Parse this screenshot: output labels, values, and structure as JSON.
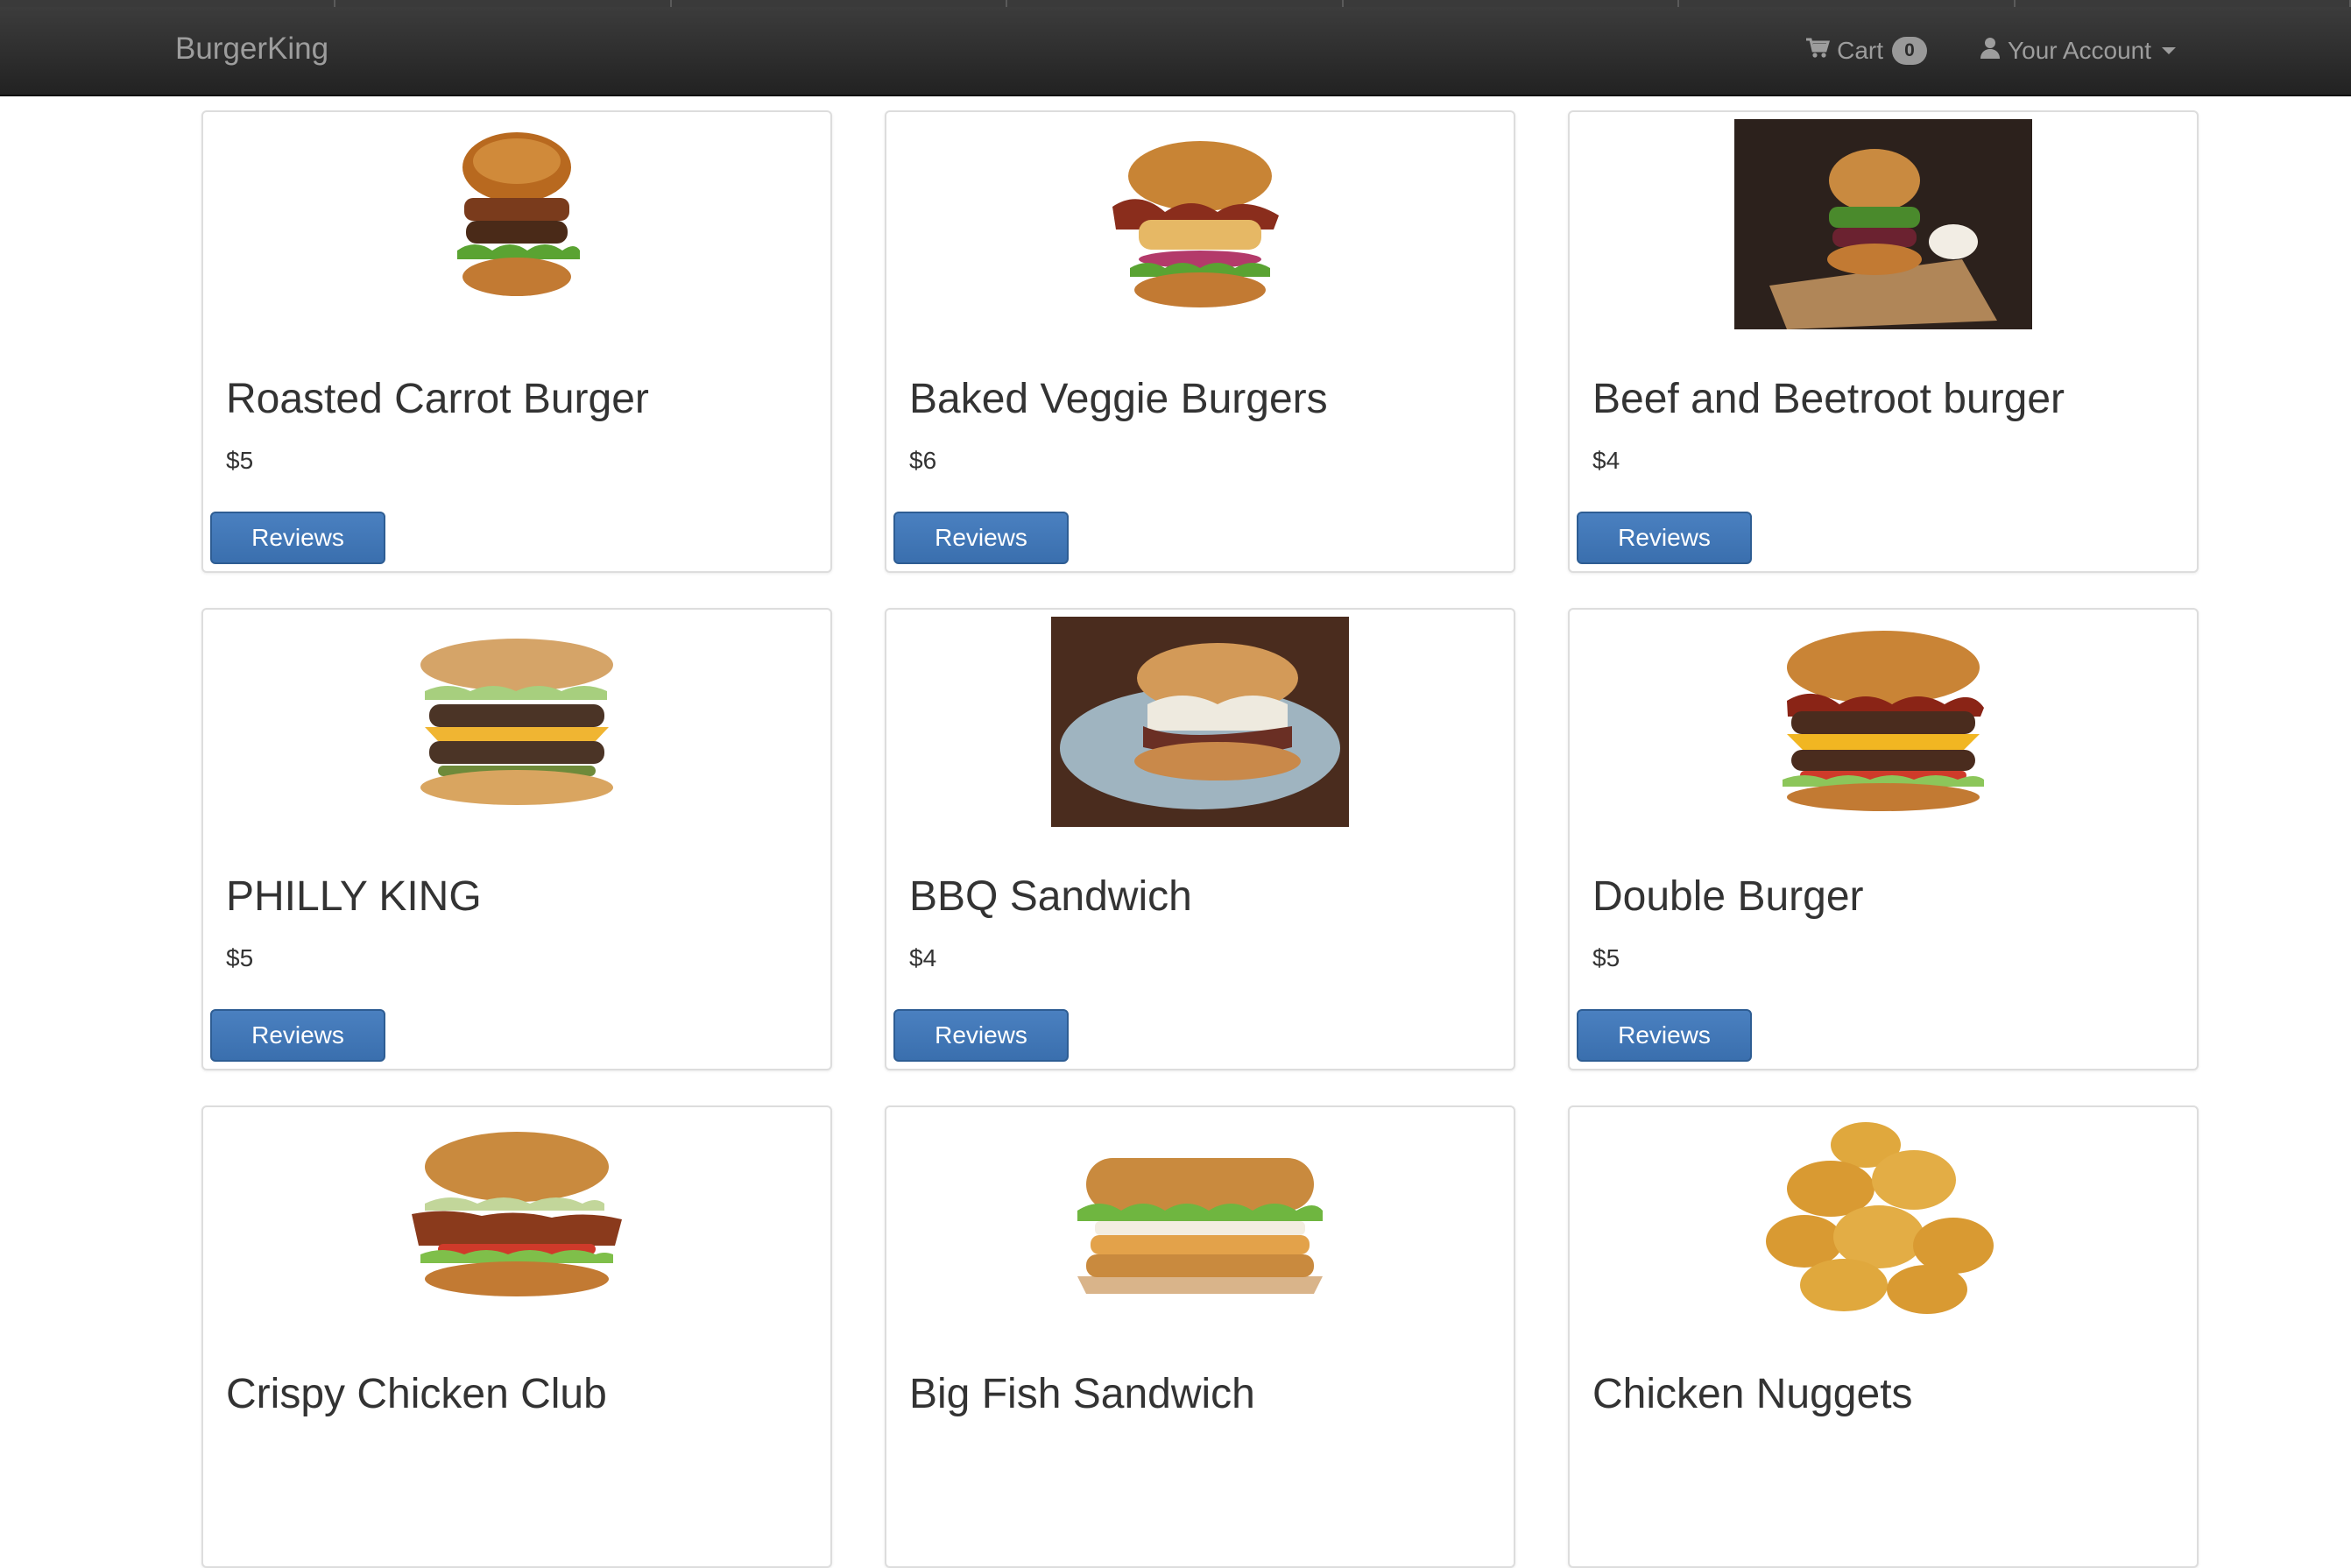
{
  "navbar": {
    "brand": "BurgerKing",
    "cart_label": "Cart",
    "cart_count": "0",
    "account_label": "Your Account",
    "background": "#222222",
    "text_color": "#9d9d9d"
  },
  "products": [
    {
      "name": "Roasted Carrot Burger",
      "price": "$5",
      "button_label": "Reviews",
      "image": "burger-image"
    },
    {
      "name": "Baked Veggie Burgers",
      "price": "$6",
      "button_label": "Reviews",
      "image": "bacon-chicken-burger-image"
    },
    {
      "name": "Beef and Beetroot burger",
      "price": "$4",
      "button_label": "Reviews",
      "image": "burger-on-board-photo"
    },
    {
      "name": "PHILLY KING",
      "price": "$5",
      "button_label": "Reviews",
      "image": "double-cheeseburger-image"
    },
    {
      "name": "BBQ Sandwich",
      "price": "$4",
      "button_label": "Reviews",
      "image": "pulled-pork-sandwich-photo"
    },
    {
      "name": "Double Burger",
      "price": "$5",
      "button_label": "Reviews",
      "image": "double-bacon-burger-image"
    },
    {
      "name": "Crispy Chicken Club",
      "price": "",
      "button_label": "",
      "image": "chicken-club-burger-image"
    },
    {
      "name": "Big Fish Sandwich",
      "price": "",
      "button_label": "",
      "image": "fish-sandwich-image"
    },
    {
      "name": "Chicken Nuggets",
      "price": "",
      "button_label": "",
      "image": "chicken-nuggets-image"
    }
  ],
  "colors": {
    "button": "#3a6fae",
    "card_border": "#dddddd",
    "text": "#333333"
  }
}
